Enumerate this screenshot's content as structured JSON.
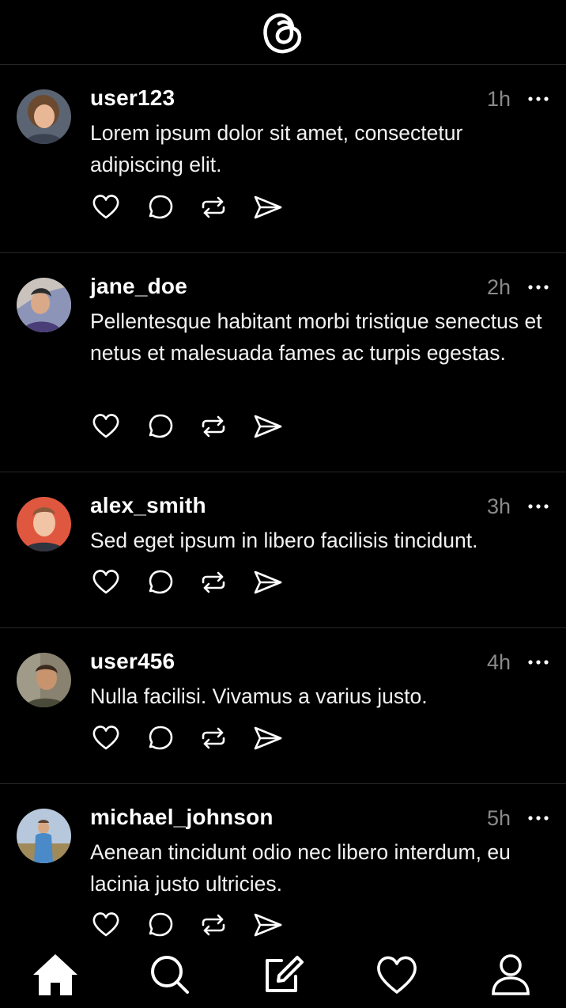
{
  "header": {
    "logo_icon": "threads-logo-icon"
  },
  "posts": [
    {
      "username": "user123",
      "time": "1h",
      "text": "Lorem ipsum dolor sit amet, consectetur adipiscing elit.",
      "avatar_color": "#8b6a4e"
    },
    {
      "username": "jane_doe",
      "time": "2h",
      "text": "Pellentesque habitant morbi tristique senectus et netus et malesuada fames ac turpis egestas.",
      "avatar_color": "#6f7fa8"
    },
    {
      "username": "alex_smith",
      "time": "3h",
      "text": "Sed eget ipsum in libero facilisis tincidunt.",
      "avatar_color": "#e0573f"
    },
    {
      "username": "user456",
      "time": "4h",
      "text": "Nulla facilisi. Vivamus a varius justo.",
      "avatar_color": "#6b5a4a"
    },
    {
      "username": "michael_johnson",
      "time": "5h",
      "text": "Aenean tincidunt odio nec libero interdum, eu lacinia justo ultricies.",
      "avatar_color": "#9fb0c4"
    }
  ],
  "post_actions": [
    "heart-icon",
    "comment-icon",
    "repost-icon",
    "share-icon"
  ],
  "tabbar": {
    "items": [
      "home-icon",
      "search-icon",
      "compose-icon",
      "activity-heart-icon",
      "profile-icon"
    ],
    "active": "home-icon"
  }
}
